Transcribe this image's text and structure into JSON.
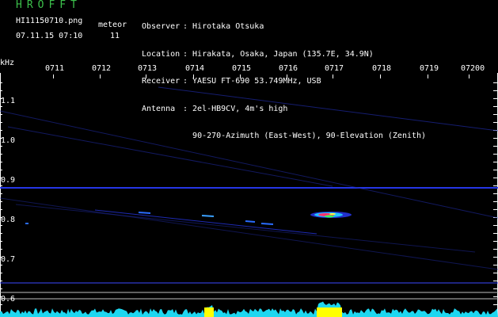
{
  "header": {
    "app_title": "HROFFT",
    "file_name": "HI11150710.png",
    "file_date": "07.11.15 07:10",
    "meteor_label": "meteor",
    "meteor_count": "11",
    "observer_key": "Observer",
    "observer_val": ": Hirotaka Otsuka",
    "location_key": "Location",
    "location_val": ": Hirakata, Osaka, Japan (135.7E, 34.9N)",
    "receiver_key": "Receiver",
    "receiver_val": ": YAESU FT-690 53.749MHz, USB",
    "antenna_key": "Antenna",
    "antenna_val": ": 2el-HB9CV, 4m's high",
    "antenna_line2": "90-270-Azimuth (East-West), 90-Elevation (Zenith)"
  },
  "axes": {
    "y_unit": "kHz",
    "x_ticks": [
      "0711",
      "0712",
      "0713",
      "0714",
      "0715",
      "0716",
      "0717",
      "0718",
      "0719",
      "07200"
    ],
    "y_ticks": [
      "1.1",
      "1.0",
      "0.9",
      "0.8",
      "0.7",
      "0.6"
    ]
  },
  "colors": {
    "background": "#000000",
    "title_green": "#3cc04b",
    "signal_blue": "#2a3cff",
    "level_cyan": "#1ed7f0",
    "level_yellow": "#ffff00"
  }
}
